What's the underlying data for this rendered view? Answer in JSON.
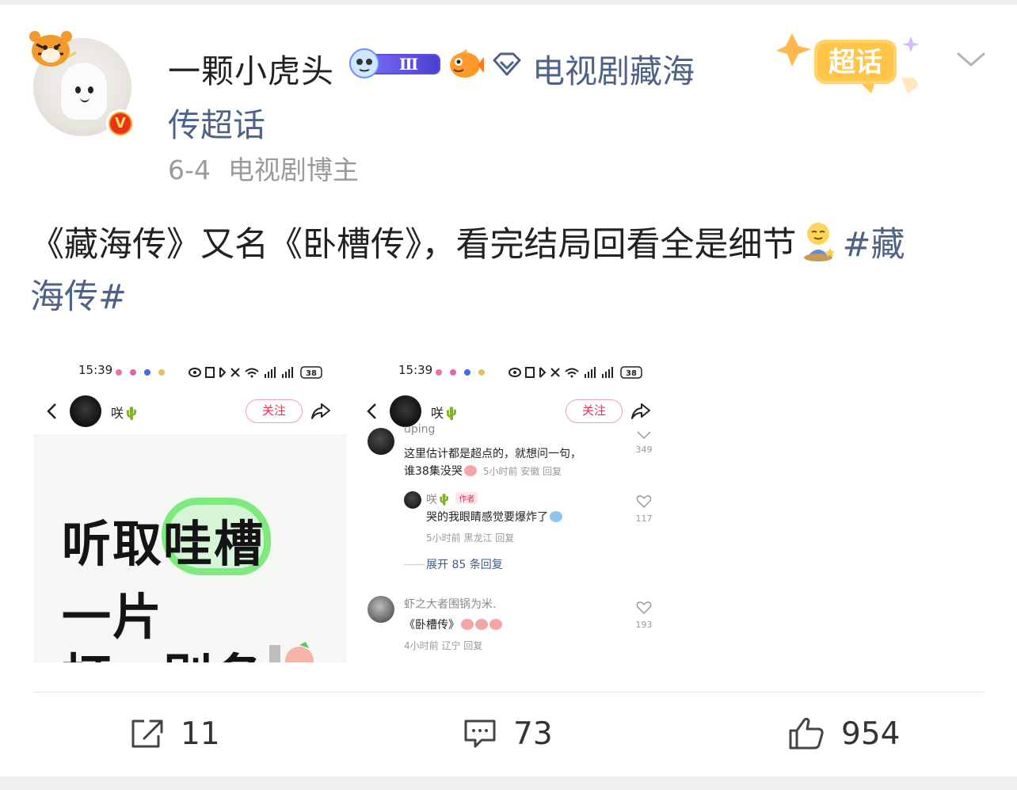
{
  "author": {
    "name": "一颗小虎头",
    "level_badge": "Ⅲ",
    "verified_badge": "V",
    "topic_line1": "电视剧藏海",
    "topic_line2": "传超话",
    "supertopic_badge": "超话",
    "post_date": "6-4",
    "role": "电视剧博主"
  },
  "post": {
    "text_main": "《藏海传》又名《卧槽传》，看完结局回看全是细节",
    "hashtag_part1": "#藏",
    "hashtag_part2": "海传#"
  },
  "screenshot_left": {
    "time": "15:39",
    "battery": "38",
    "signal": "5G",
    "user": "咲🌵",
    "follow": "关注",
    "line1_prefix": "听取",
    "line1_highlight": "哇槽",
    "line2": "一片",
    "line3": "打　别名"
  },
  "screenshot_right": {
    "time": "15:39",
    "battery": "38",
    "signal": "5G",
    "user": "咲🌵",
    "follow": "关注",
    "c1_name": "uping",
    "c1_text1": "这里估计都是超点的，就想问一句，",
    "c1_text2": "谁38集没哭",
    "c1_meta": "5小时前 安徽  回复",
    "c1_likes": "349",
    "r1_name": "咲🌵",
    "r1_tag": "作者",
    "r1_text": "哭的我眼睛感觉要爆炸了",
    "r1_meta": "5小时前 黑龙江  回复",
    "r1_likes": "117",
    "expand": "展开 85 条回复",
    "c2_name": "虾之大者围锅为米.",
    "c2_text": "《卧槽传》",
    "c2_meta": "4小时前 辽宁  回复",
    "c2_likes": "193"
  },
  "actions": {
    "repost_count": "11",
    "comment_count": "73",
    "like_count": "954"
  },
  "colors": {
    "link": "#4e6288",
    "follow_red": "#ee2d55",
    "highlight_green": "#7dea7e"
  },
  "icons": [
    "chevron-down-icon",
    "repost-icon",
    "comment-icon",
    "like-icon",
    "back-icon",
    "share-icon",
    "heart-icon",
    "diamond-icon"
  ]
}
